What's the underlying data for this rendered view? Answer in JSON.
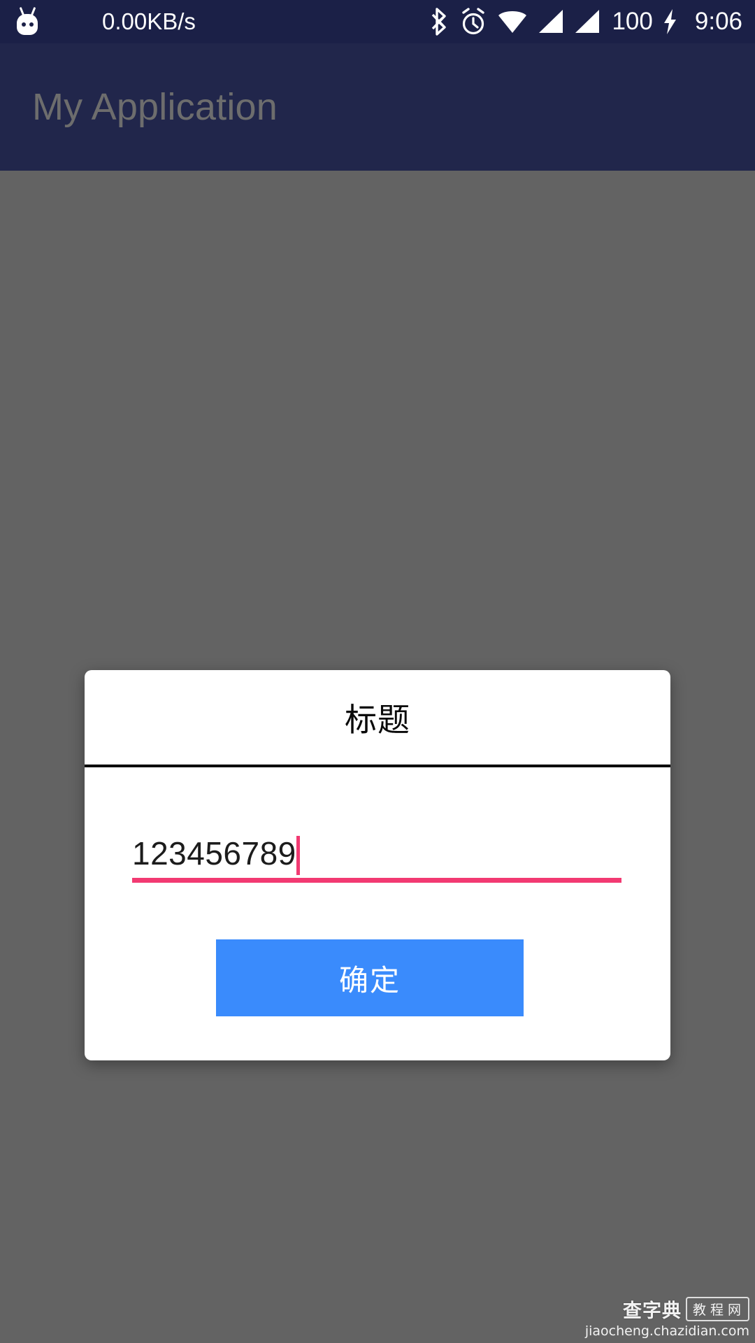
{
  "status_bar": {
    "background": "#1b2047",
    "robot_icon": "android-robot-icon",
    "network_speed": "0.00KB/s",
    "icons": [
      "bluetooth-icon",
      "alarm-clock-icon",
      "wifi-icon",
      "signal-sim1-icon",
      "signal-sim2-icon"
    ],
    "battery_level": "100",
    "charging_icon": "lightning-bolt-icon",
    "clock": "9:06"
  },
  "app_bar": {
    "background": "#21264b",
    "title": "My Application",
    "title_color": "#6d6d6d"
  },
  "content": {
    "background": "#636363"
  },
  "dialog": {
    "title": "标题",
    "input": {
      "value": "123456789",
      "placeholder": "",
      "accent_color": "#f23a72",
      "caret_visible": true
    },
    "confirm_button": {
      "label": "确定",
      "background": "#3a8bfc",
      "text_color": "#ffffff"
    }
  },
  "watermark": {
    "brand": "查字典",
    "tag": "教程网",
    "url": "jiaocheng.chazidian.com"
  }
}
